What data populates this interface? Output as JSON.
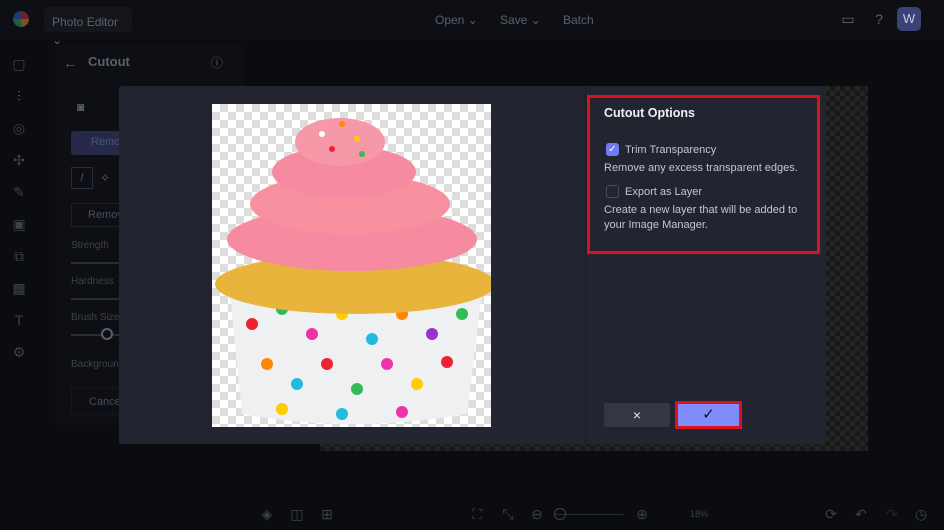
{
  "topbar": {
    "app_menu": "Photo Editor",
    "open": "Open",
    "save": "Save",
    "batch": "Batch",
    "avatar": "W"
  },
  "panel": {
    "title": "Cutout",
    "remove_bg": "Remo",
    "remove": "Remov",
    "strength": "Strength",
    "hardness": "Hardness",
    "brush_size": "Brush Size",
    "background": "Backgroun",
    "cancel": "Cance"
  },
  "modal": {
    "title": "Cutout Options",
    "options": [
      {
        "label": "Trim Transparency",
        "checked": true,
        "description": "Remove any excess transparent edges."
      },
      {
        "label": "Export as Layer",
        "checked": false,
        "description": "Create a new layer that will be added to your Image Manager."
      }
    ],
    "cancel_icon": "×",
    "confirm_icon": "✓"
  },
  "bottombar": {
    "zoom": "18%"
  },
  "colors": {
    "accent": "#7b86f5",
    "highlight": "#e0101a",
    "modal_bg": "#22242f"
  }
}
